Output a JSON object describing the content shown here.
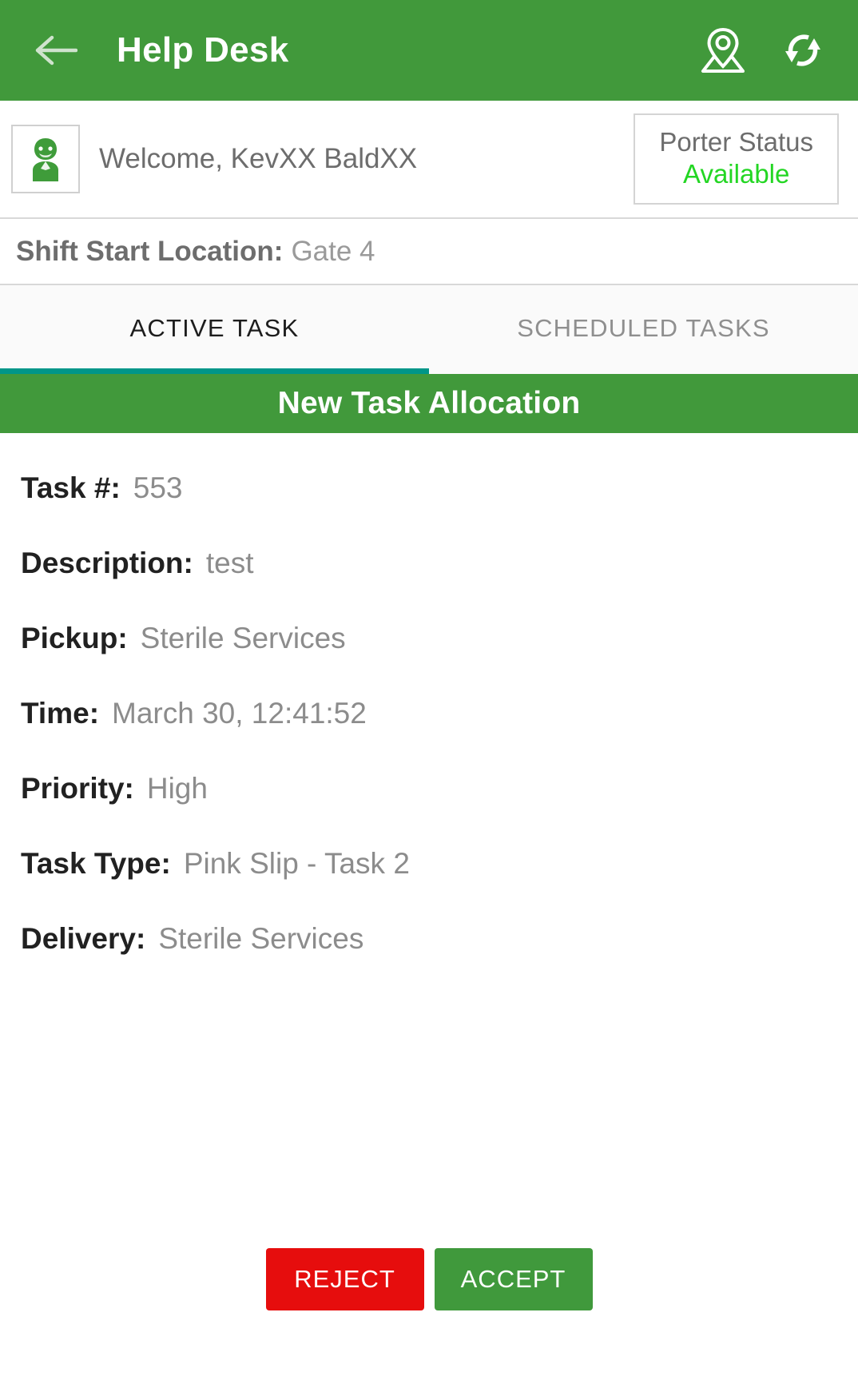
{
  "appbar": {
    "back_icon": "arrow-left-icon",
    "title": "Help Desk",
    "location_icon": "map-location-pin-icon",
    "refresh_icon": "refresh-sync-icon",
    "background_color": "#41993b",
    "text_color": "#ffffff"
  },
  "welcome": {
    "avatar_icon": "user-avatar-icon",
    "greeting": "Welcome, KevXX BaldXX",
    "status_label": "Porter Status",
    "status_value": "Available",
    "status_value_color": "#23d623"
  },
  "shift": {
    "label": "Shift Start Location:",
    "value": "Gate 4"
  },
  "tabs": {
    "active_index": 0,
    "indicator_color": "#009688",
    "items": [
      {
        "label": "ACTIVE TASK",
        "active": true
      },
      {
        "label": "SCHEDULED TASKS",
        "active": false
      }
    ]
  },
  "section": {
    "title": "New Task Allocation",
    "background_color": "#41993b"
  },
  "task": {
    "fields": [
      {
        "label": "Task #:",
        "value": "553"
      },
      {
        "label": "Description:",
        "value": "test"
      },
      {
        "label": "Pickup:",
        "value": "Sterile Services"
      },
      {
        "label": "Time:",
        "value": "March 30, 12:41:52"
      },
      {
        "label": "Priority:",
        "value": "High"
      },
      {
        "label": "Task Type:",
        "value": "Pink Slip - Task 2"
      },
      {
        "label": "Delivery:",
        "value": "Sterile Services"
      }
    ]
  },
  "actions": {
    "reject_label": "REJECT",
    "reject_color": "#e60d0d",
    "accept_label": "ACCEPT",
    "accept_color": "#40993c"
  }
}
